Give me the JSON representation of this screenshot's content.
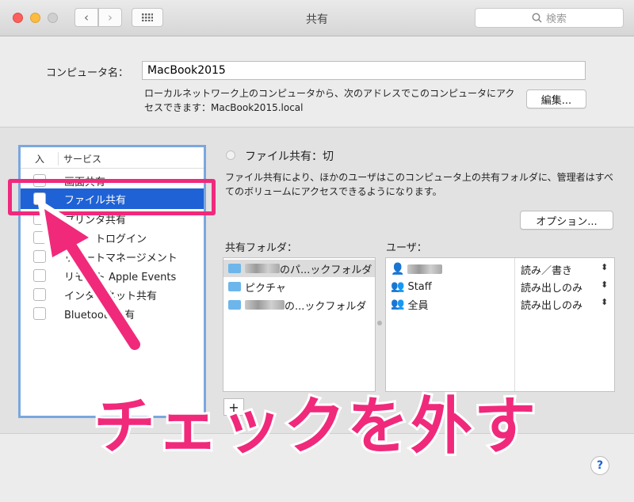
{
  "window": {
    "title": "共有",
    "search_placeholder": "検索"
  },
  "header": {
    "computer_name_label": "コンピュータ名：",
    "computer_name_value": "MacBook2015",
    "description": "ローカルネットワーク上のコンピュータから、次のアドレスでこのコンピュータにアクセスできます：MacBook2015.local",
    "edit_button": "編集..."
  },
  "services": {
    "col_on": "入",
    "col_service": "サービス",
    "items": [
      {
        "label": "画面共有",
        "checked": false,
        "selected": false
      },
      {
        "label": "ファイル共有",
        "checked": false,
        "selected": true
      },
      {
        "label": "プリンタ共有",
        "checked": false,
        "selected": false
      },
      {
        "label": "リモートログイン",
        "checked": false,
        "selected": false
      },
      {
        "label": "リモートマネージメント",
        "checked": false,
        "selected": false
      },
      {
        "label": "リモート Apple Events",
        "checked": false,
        "selected": false
      },
      {
        "label": "インターネット共有",
        "checked": false,
        "selected": false
      },
      {
        "label": "Bluetooth共有",
        "checked": false,
        "selected": false
      }
    ]
  },
  "detail": {
    "status": "ファイル共有：切",
    "description": "ファイル共有により、ほかのユーザはこのコンピュータ上の共有フォルダに、管理者はすべてのボリュームにアクセスできるようになります。",
    "options_button": "オプション...",
    "shared_folders_label": "共有フォルダ：",
    "users_label": "ユーザ：",
    "folders": [
      "のパ...ックフォルダ",
      "ピクチャ",
      "の...ックフォルダ"
    ],
    "users": [
      {
        "name": "",
        "permission": "読み／書き"
      },
      {
        "name": "Staff",
        "permission": "読み出しのみ"
      },
      {
        "name": "全員",
        "permission": "読み出しのみ"
      }
    ],
    "add_button": "+"
  },
  "annotation": {
    "text": "チェックを外す",
    "color": "#f0297b"
  },
  "help_button": "?"
}
